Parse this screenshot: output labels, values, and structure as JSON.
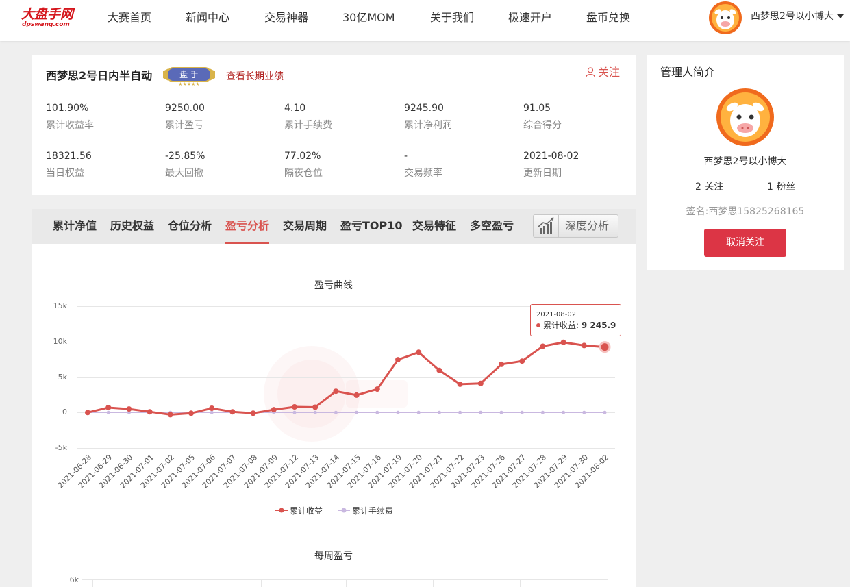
{
  "brand": {
    "logo_main": "大盘手网",
    "logo_sub": "dpswang.com"
  },
  "nav": [
    "大赛首页",
    "新闻中心",
    "交易神器",
    "30亿MOM",
    "关于我们",
    "极速开户",
    "盘币兑换"
  ],
  "user": {
    "name": "西梦思2号以小博大"
  },
  "product": {
    "title": "西梦思2号日内半自动",
    "badge_text": "盘 手",
    "link_label": "查看长期业绩",
    "follow_label": "关注"
  },
  "stats": [
    {
      "value": "101.90%",
      "label": "累计收益率"
    },
    {
      "value": "9250.00",
      "label": "累计盈亏"
    },
    {
      "value": "4.10",
      "label": "累计手续费"
    },
    {
      "value": "9245.90",
      "label": "累计净利润"
    },
    {
      "value": "91.05",
      "label": "综合得分"
    },
    {
      "value": "18321.56",
      "label": "当日权益"
    },
    {
      "value": "-25.85%",
      "label": "最大回撤"
    },
    {
      "value": "77.02%",
      "label": "隔夜仓位"
    },
    {
      "value": "-",
      "label": "交易频率"
    },
    {
      "value": "2021-08-02",
      "label": "更新日期"
    }
  ],
  "tabs": {
    "items": [
      "累计净值",
      "历史权益",
      "仓位分析",
      "盈亏分析",
      "交易周期",
      "盈亏TOP10",
      "交易特征",
      "多空盈亏"
    ],
    "active": "盈亏分析",
    "deep_label": "深度分析"
  },
  "tooltip": {
    "date": "2021-08-02",
    "series": "累计收益",
    "value": "9 245.9"
  },
  "colors": {
    "accent": "#d9534f",
    "fee_line": "#c9b8e0",
    "brand": "#d5161c"
  },
  "chart_data": [
    {
      "type": "line",
      "title": "盈亏曲线",
      "x": [
        "2021-06-28",
        "2021-06-29",
        "2021-06-30",
        "2021-07-01",
        "2021-07-02",
        "2021-07-05",
        "2021-07-06",
        "2021-07-07",
        "2021-07-08",
        "2021-07-09",
        "2021-07-12",
        "2021-07-13",
        "2021-07-14",
        "2021-07-15",
        "2021-07-16",
        "2021-07-19",
        "2021-07-20",
        "2021-07-21",
        "2021-07-22",
        "2021-07-23",
        "2021-07-26",
        "2021-07-27",
        "2021-07-28",
        "2021-07-29",
        "2021-07-30",
        "2021-08-02"
      ],
      "series": [
        {
          "name": "累计收益",
          "color": "#d9534f",
          "values": [
            0,
            700,
            500,
            100,
            -300,
            -100,
            600,
            100,
            -100,
            400,
            800,
            750,
            3000,
            2450,
            3300,
            7450,
            8500,
            5950,
            4000,
            4100,
            6800,
            7250,
            9350,
            9900,
            9450,
            9245.9
          ]
        },
        {
          "name": "累计手续费",
          "color": "#c9b8e0",
          "values": [
            0,
            0.2,
            0.3,
            0.4,
            0.5,
            0.6,
            0.7,
            0.8,
            0.9,
            1.0,
            1.1,
            1.2,
            1.3,
            1.4,
            1.5,
            1.6,
            1.7,
            1.8,
            2.0,
            2.3,
            2.6,
            2.9,
            3.2,
            3.5,
            3.8,
            4.1
          ]
        }
      ],
      "ylim": [
        -5000,
        15000
      ],
      "yticks": [
        "15k",
        "10k",
        "5k",
        "0",
        "-5k"
      ],
      "grid": true,
      "legend": "bottom"
    },
    {
      "type": "bar",
      "title": "每周盈亏",
      "yticks": [
        "6k"
      ]
    }
  ],
  "manager": {
    "title": "管理人简介",
    "name": "西梦思2号以小博大",
    "following": "2 关注",
    "fans": "1 粉丝",
    "signature": "签名:西梦思15825268165",
    "unfollow_label": "取消关注"
  }
}
